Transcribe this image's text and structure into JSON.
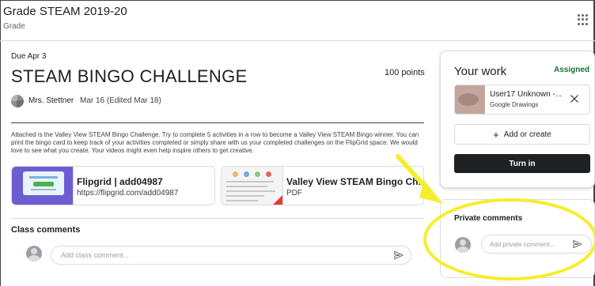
{
  "header": {
    "class_title": "Grade STEAM 2019-20",
    "class_subtitle": "Grade",
    "apps_icon": "apps-grid-icon"
  },
  "assignment": {
    "due": "Due Apr 3",
    "title": "STEAM BINGO CHALLENGE",
    "points": "100 points",
    "author": "Mrs. Stettner",
    "date": "Mar 16 (Edited Mar 18)",
    "description": "Attached is the Valley View STEAM Bingo Challenge. Try to complete 5 activities in a row to become a Valley View STEAM Bingo winner. You can print the bingo card to keep track of your activities completed or simply share with us your completed challenges on the FlipGrid space. We would love to see what you create. Your videos might even help inspire others to get creative."
  },
  "attachments": [
    {
      "title": "Flipgrid | add04987",
      "subtitle": "https://flipgrid.com/add04987"
    },
    {
      "title": "Valley View STEAM Bingo Ch...",
      "subtitle": "PDF"
    }
  ],
  "class_comments": {
    "label": "Class comments",
    "placeholder": "Add class comment..."
  },
  "your_work": {
    "title": "Your work",
    "status": "Assigned",
    "file_name": "User17 Unknown -...",
    "file_type": "Google Drawings",
    "add_label": "Add or create",
    "turn_in_label": "Turn in"
  },
  "private_comments": {
    "label": "Private comments",
    "placeholder": "Add private comment..."
  },
  "colors": {
    "assigned_green": "#137333",
    "annotation_yellow": "#f5ee30",
    "turn_in_bg": "#202124"
  }
}
